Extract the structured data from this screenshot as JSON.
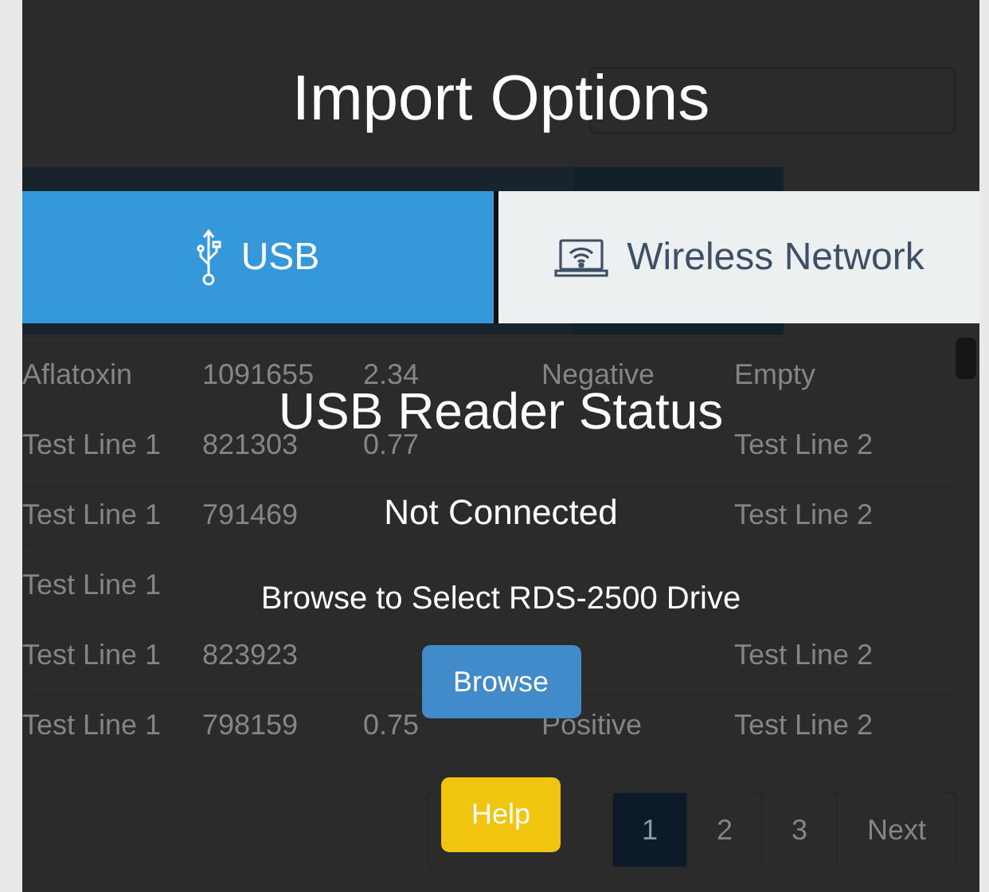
{
  "background_page": {
    "table_rows": [
      {
        "column_1": "Aflatoxin",
        "column_2": "1091655",
        "column_3": "2.34",
        "column_4": "Negative",
        "column_5": "Empty"
      },
      {
        "column_1": "Test Line 1",
        "column_2": "821303",
        "column_3": "0.77",
        "column_5": "Test Line 2"
      },
      {
        "column_1": "Test Line 1",
        "column_2": "791469",
        "column_5": "Test Line 2"
      },
      {
        "column_1": "Test Line 1"
      },
      {
        "column_1": "Test Line 1",
        "column_2": "823923",
        "column_5": "Test Line 2"
      },
      {
        "column_1": "Test Line 1",
        "column_2": "798159",
        "column_3": "0.75",
        "column_4": "Positive",
        "column_5": "Test Line 2"
      }
    ],
    "pagination": {
      "pages": [
        {
          "label": "1",
          "selected": true
        },
        {
          "label": "2",
          "selected": false
        },
        {
          "label": "3",
          "selected": false
        }
      ],
      "next": "Next"
    }
  },
  "dialog": {
    "title": "Import Options",
    "tabs": [
      {
        "label": "USB",
        "kind": "usb",
        "selected": true
      },
      {
        "label": "Wireless Network",
        "kind": "wireless",
        "selected": false
      }
    ],
    "status_heading": "USB Reader Status",
    "status": "Not Connected",
    "instruction": "Browse to Select RDS-2500 Drive",
    "browse_button": "Browse",
    "help_button": "Help"
  }
}
